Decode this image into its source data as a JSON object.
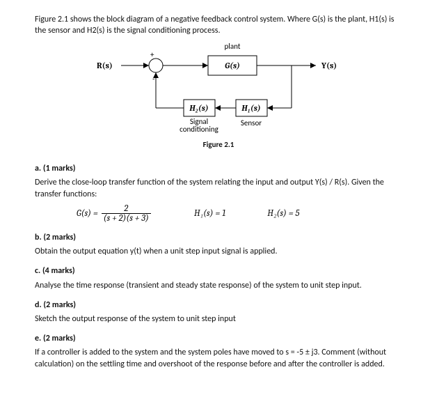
{
  "intro": "Figure 2.1 shows the block diagram of a negative feedback control system. Where G(s) is the plant, H1(s) is the sensor and H2(s) is the signal conditioning process.",
  "diagram": {
    "plant_label": "plant",
    "input": "R(s)",
    "output": "Y(s)",
    "plant_block": "G(s)",
    "h2_block": "H₂(s)",
    "h1_block": "H₁(s)",
    "signal_cond_line1": "Signal",
    "signal_cond_line2": "conditioning",
    "sensor_label": "Sensor",
    "sum_plus": "+",
    "sum_minus": "-",
    "figure_caption": "Figure 2.1"
  },
  "a": {
    "head": "a. (1 marks)",
    "text": "Derive the close-loop transfer function of the system relating the input and output Y(s) / R(s). Given the transfer functions:",
    "G_lhs": "G(s) =",
    "G_num": "2",
    "G_den": "(s + 2)(s + 3)",
    "H1": "H₁(s) = 1",
    "H2": "H₂(s) = 5"
  },
  "b": {
    "head": "b. (2 marks)",
    "text": "Obtain the output equation y(t) when a unit step input signal is applied."
  },
  "c": {
    "head": "c. (4 marks)",
    "text": "Analyse the time response (transient and steady state response) of the system to unit step input."
  },
  "d": {
    "head": "d. (2 marks)",
    "text": "Sketch the output response of the system to unit step input"
  },
  "e": {
    "head": "e. (2 marks)",
    "text": "If a controller is added to the system and the system poles have moved to s = -5 ± j3. Comment (without calculation) on the settling time and overshoot of the response before and after the controller is added."
  }
}
